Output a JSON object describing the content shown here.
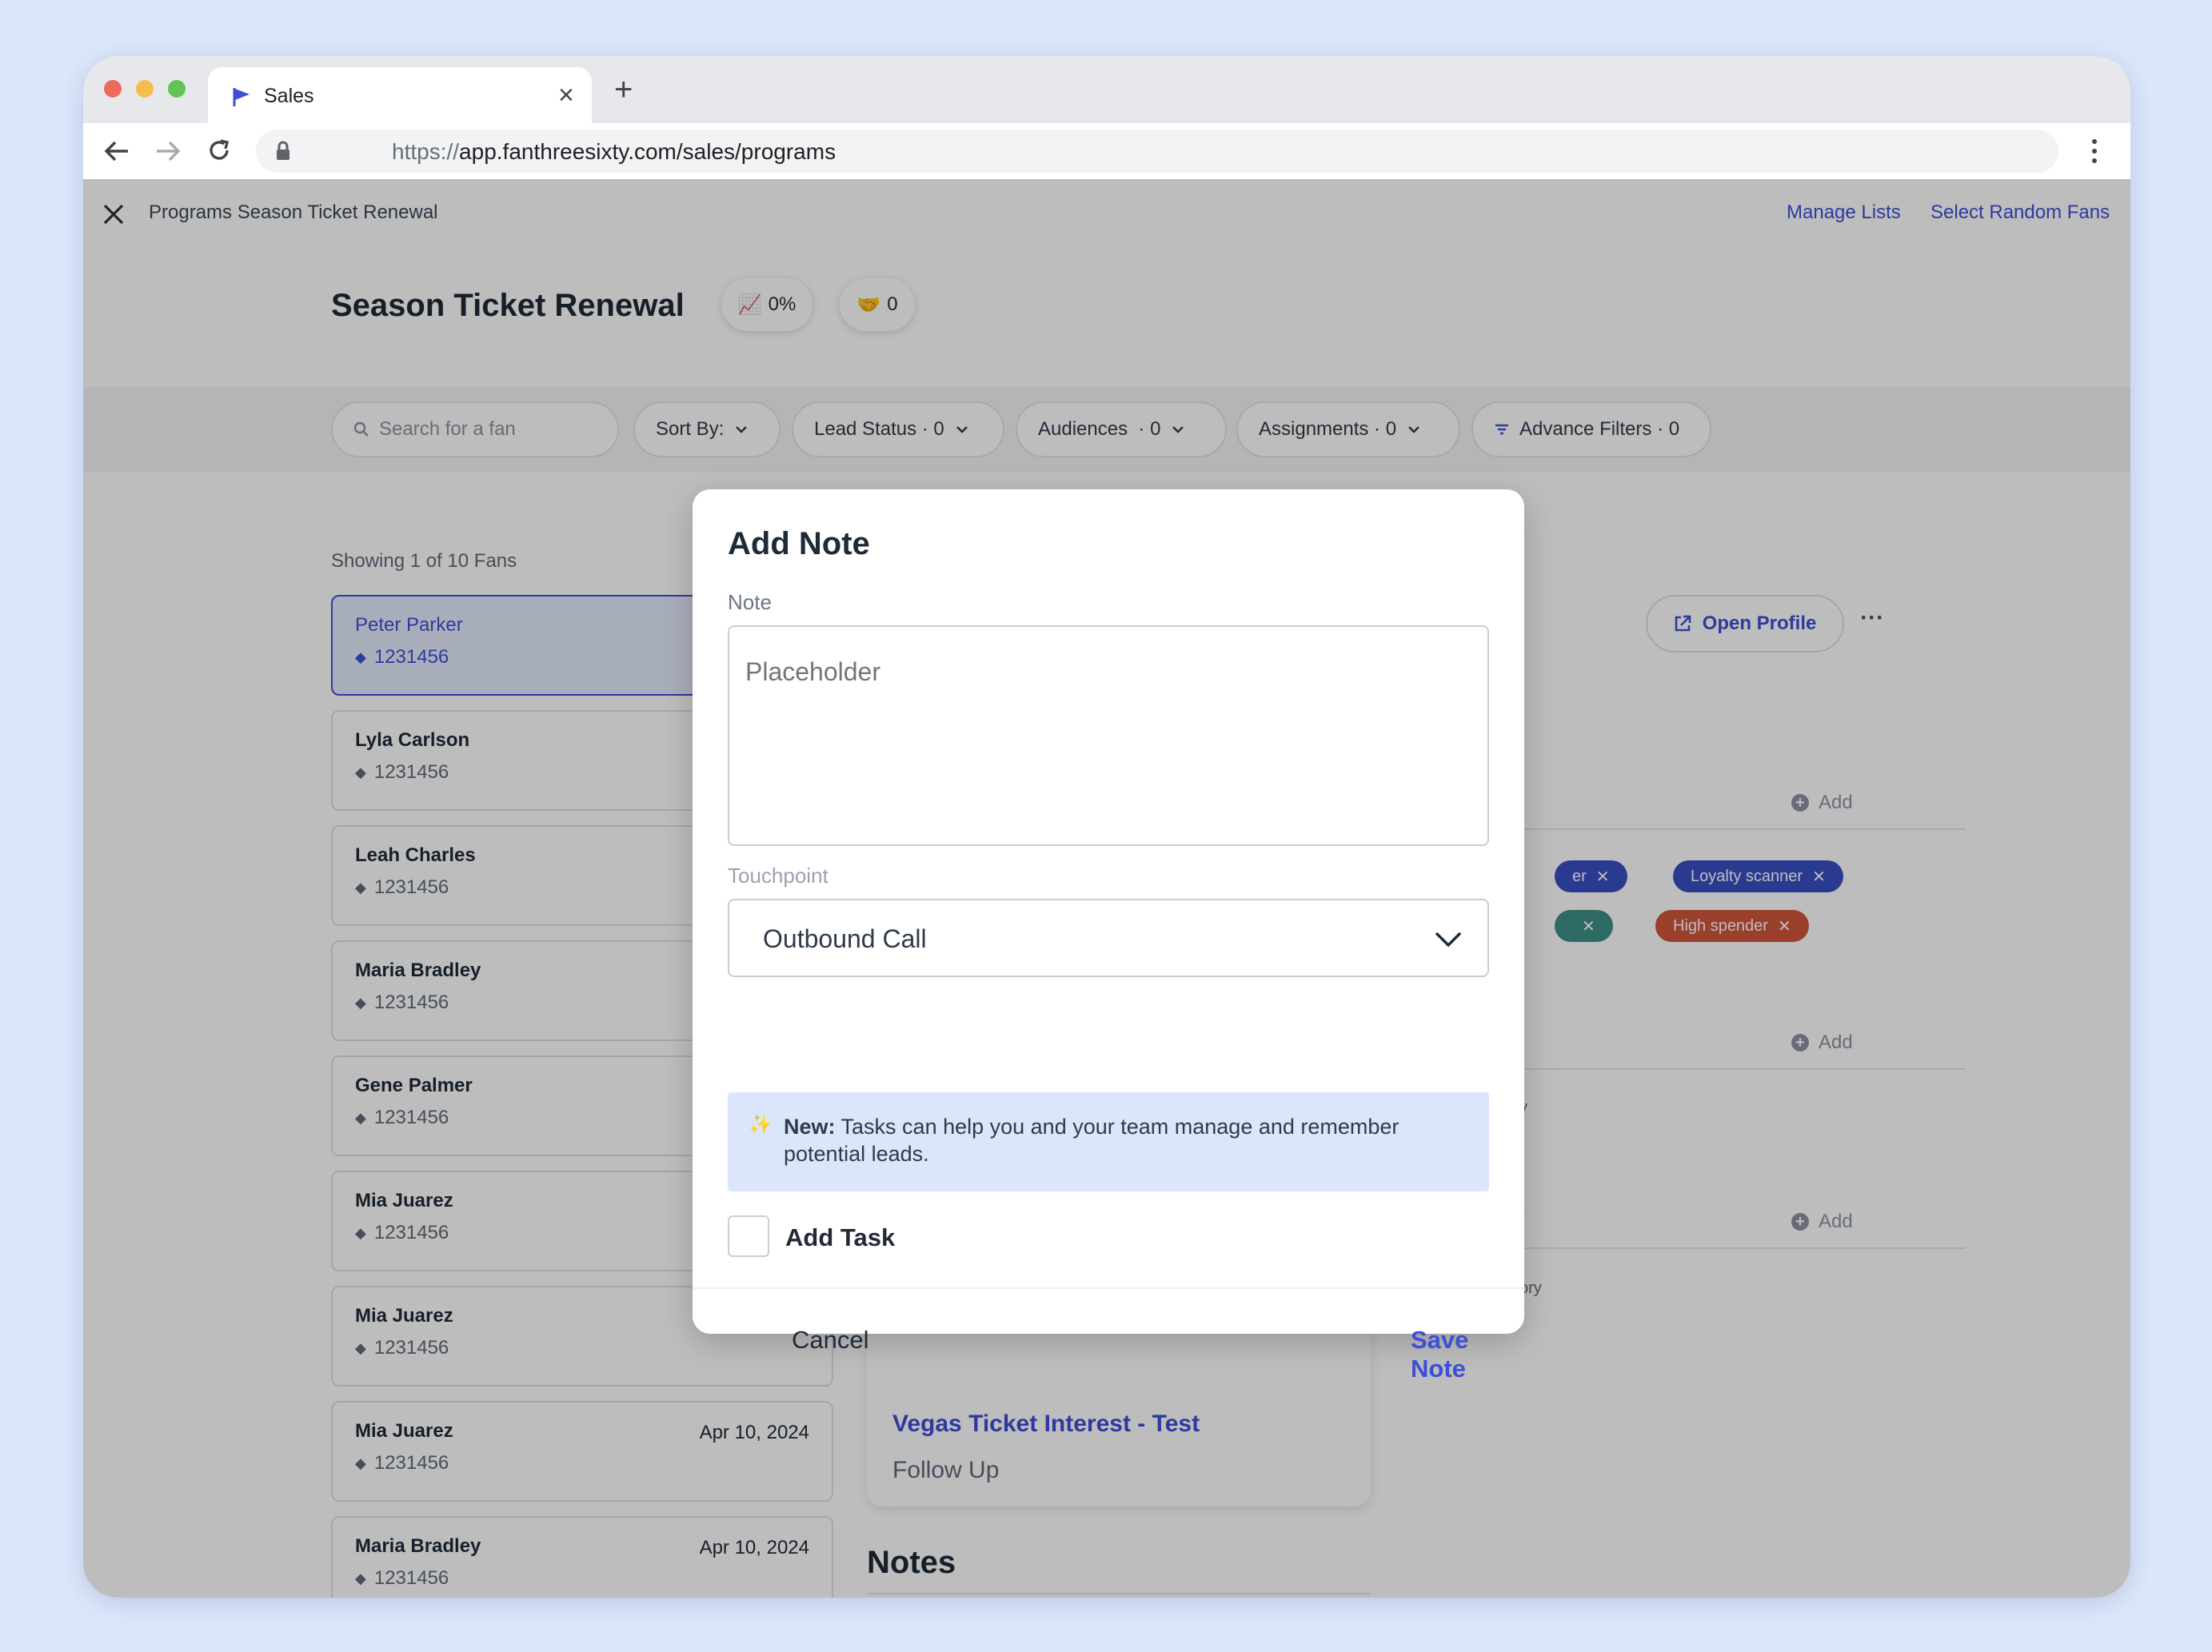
{
  "browser": {
    "tab_title": "Sales",
    "tab_close": "×",
    "new_tab": "+",
    "url": "https://app.fanthreesixty.com/sales/programs",
    "url_scheme": "https://",
    "url_rest": "app.fanthreesixty.com/sales/programs"
  },
  "topbar": {
    "breadcrumb": "Programs Season Ticket Renewal",
    "links": [
      "Manage Lists",
      "Select Random Fans"
    ]
  },
  "header": {
    "title": "Season Ticket Renewal",
    "badges": [
      {
        "icon": "chart-increasing-icon",
        "glyph": "📈",
        "value": "0%"
      },
      {
        "icon": "handshake-icon",
        "glyph": "🤝",
        "value": "0"
      }
    ]
  },
  "filters": {
    "search_placeholder": "Search for a fan",
    "sort_by": "Sort By:",
    "lead_status": "Lead Status · 0",
    "audiences": "Audiences  · 0",
    "assignments": "Assignments · 0",
    "advance_filters": "Advance Filters · 0"
  },
  "fan_list": {
    "showing": "Showing 1 of 10 Fans",
    "fans": [
      {
        "name": "Peter Parker",
        "id": "1231456",
        "date": ""
      },
      {
        "name": "Lyla Carlson",
        "id": "1231456",
        "date": ""
      },
      {
        "name": "Leah Charles",
        "id": "1231456",
        "date": ""
      },
      {
        "name": "Maria Bradley",
        "id": "1231456",
        "date": ""
      },
      {
        "name": "Gene Palmer",
        "id": "1231456",
        "date": ""
      },
      {
        "name": "Mia Juarez",
        "id": "1231456",
        "date": ""
      },
      {
        "name": "Mia Juarez",
        "id": "1231456",
        "date": ""
      },
      {
        "name": "Mia Juarez",
        "id": "1231456",
        "date": "Apr 10, 2024"
      },
      {
        "name": "Maria Bradley",
        "id": "1231456",
        "date": "Apr 10, 2024"
      }
    ]
  },
  "detail": {
    "open_profile": "Open Profile",
    "more": "···",
    "add_label": "Add",
    "tags": [
      {
        "label": "er",
        "color": "#3b4fc4"
      },
      {
        "label": "Loyalty scanner",
        "color": "#3b4fc4"
      },
      {
        "label": "",
        "color": "#3f8f88"
      },
      {
        "label": "High spender",
        "color": "#d0563a"
      }
    ],
    "partial_y": "y",
    "partial_r": "r",
    "partial_ory": "ory",
    "task_card_title": "Vegas Ticket Interest - Test",
    "task_card_sub": "Follow Up",
    "notes_heading": "Notes"
  },
  "modal": {
    "title": "Add Note",
    "note_label": "Note",
    "note_placeholder": "Placeholder",
    "touchpoint_label": "Touchpoint",
    "touchpoint_value": "Outbound Call",
    "info_icon": "sparkles-icon",
    "info_glyph": "✨",
    "info_bold": "New:",
    "info_text": " Tasks can help you and your team manage and remember potential leads.",
    "add_task_label": "Add Task",
    "add_task_checked": false,
    "cancel": "Cancel",
    "save": "Save Note"
  },
  "colors": {
    "accent": "#3d4fd6",
    "info_bg": "#dbe6fd",
    "selected_card": "#e4ebfc",
    "page_bg": "#dce7fc"
  }
}
